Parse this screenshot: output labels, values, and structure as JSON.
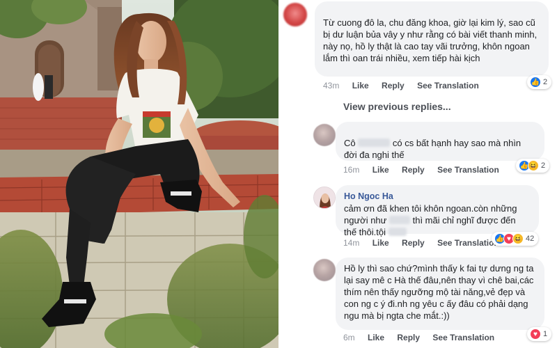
{
  "comments": [
    {
      "text": "Từ cuong đô la, chu đăng khoa, giờ lại kim lý, sao cũ bị dư luận bủa vây y như rằng có bài viết thanh minh, này nọ, hồ ly thật là cao tay vãi trưởng, khôn ngoan lắm thì oan trái nhiều, xem tiếp hài kịch",
      "time": "43m",
      "like": "Like",
      "reply": "Reply",
      "see_translation": "See Translation",
      "reaction_count": "2",
      "avatar": "blurred-red"
    },
    {
      "text_a": "Cô",
      "text_b": "có cs bất hạnh hay sao mà nhìn đời đa nghi thế",
      "time": "16m",
      "like": "Like",
      "reply": "Reply",
      "see_translation": "See Translation",
      "reaction_count": "2"
    },
    {
      "author": "Ho Ngoc Ha",
      "text_a": "cảm ơn đã khen tôi khôn ngoan.còn những người như",
      "text_b": "thì mãi chỉ nghĩ được đến thế thôi.tội",
      "time": "14m",
      "like": "Like",
      "reply": "Reply",
      "see_translation": "See Translation",
      "reaction_count": "42"
    },
    {
      "text": "Hồ ly thì sao chứ?mình thấy k fai tự dưng ng ta lại say mê c Hà thế đâu,nên thay vì chê bai,các thím nên thấy ngưỡng mộ tài năng,vẻ đẹp và con ng c ý đi.nh ng yêu c ấy đâu có phải dạng ngu mà bị ngta che mắt.:))",
      "time": "6m",
      "like": "Like",
      "reply": "Reply",
      "see_translation": "See Translation",
      "reaction_count": "1"
    }
  ],
  "view_previous_replies": "View previous replies...",
  "reactions": {
    "like": "like-icon",
    "love": "love-icon",
    "haha": "haha-icon"
  },
  "photo": {
    "subject": "woman seated on a brick wall",
    "tshirt_print": "GUCCI",
    "colors": {
      "sky": "#cfd9d2",
      "brick": "#b24a37",
      "pants": "#1a1a1a"
    }
  },
  "colors": {
    "link": "#385898",
    "bubble": "#f2f3f5",
    "meta": "#90949c",
    "like_blue": "#1877f2"
  }
}
